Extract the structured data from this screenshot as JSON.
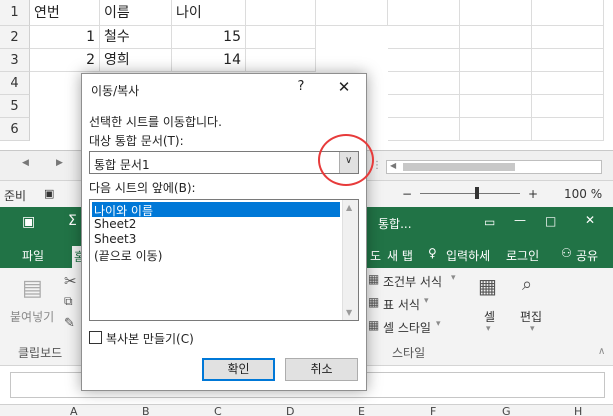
{
  "sheet": {
    "rows": [
      {
        "num": "1",
        "a": "연번",
        "b": "이름",
        "c": "나이"
      },
      {
        "num": "2",
        "a": "1",
        "b": "철수",
        "c": "15"
      },
      {
        "num": "3",
        "a": "2",
        "b": "영희",
        "c": "14"
      },
      {
        "num": "4",
        "a": "",
        "b": "",
        "c": ""
      },
      {
        "num": "5",
        "a": "",
        "b": "",
        "c": ""
      },
      {
        "num": "6",
        "a": "",
        "b": "",
        "c": ""
      }
    ],
    "status_ready": "준비",
    "zoom": "100 %"
  },
  "excel": {
    "title": "통합...",
    "tabs": {
      "file": "파일",
      "home_partial": "홈",
      "tab_a": "도",
      "tab_b": "새 탭",
      "tell_me": "입력하세",
      "login": "로그인",
      "share": "공유"
    },
    "ribbon": {
      "paste": "붙여넣기",
      "clipboard": "클립보드",
      "cond_format": "조건부 서식",
      "table_format": "표 서식",
      "cell_style": "셀 스타일",
      "style_group": "스타일",
      "cells": "셀",
      "editing": "편집"
    },
    "col_headers": [
      "A",
      "B",
      "C",
      "D",
      "E",
      "F",
      "G",
      "H"
    ]
  },
  "dialog": {
    "title": "이동/복사",
    "help": "?",
    "close": "✕",
    "instruction": "선택한 시트를 이동합니다.",
    "target_label": "대상 통합 문서(T):",
    "target_value": "통합 문서1",
    "before_label": "다음 시트의 앞에(B):",
    "sheets": [
      "나이와 이름",
      "Sheet2",
      "Sheet3",
      "(끝으로 이동)"
    ],
    "copy_label": "복사본 만들기(C)",
    "ok": "확인",
    "cancel": "취소"
  },
  "colors": {
    "excel_green": "#217346",
    "selection": "#0078d7",
    "annotation": "#e73b3b"
  }
}
